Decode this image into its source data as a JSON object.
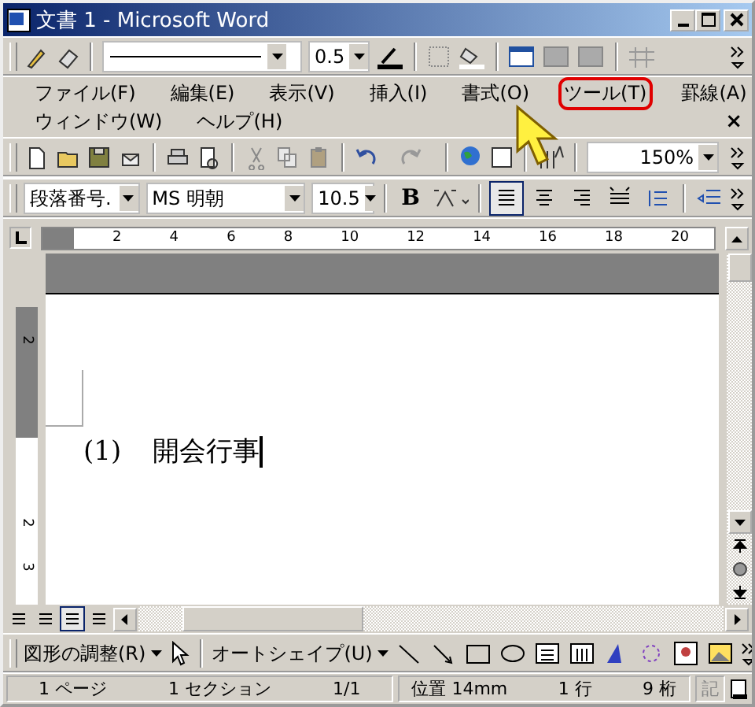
{
  "window": {
    "title": "文書 1 - Microsoft Word"
  },
  "borders_toolbar": {
    "line_weight": "0.5"
  },
  "menu": {
    "rows": [
      [
        {
          "label": "ファイル(F)",
          "selected": false
        },
        {
          "label": "編集(E)",
          "selected": false
        },
        {
          "label": "表示(V)",
          "selected": false
        },
        {
          "label": "挿入(I)",
          "selected": false
        },
        {
          "label": "書式(O)",
          "selected": false
        },
        {
          "label": "ツール(T)",
          "selected": true
        },
        {
          "label": "罫線(A)",
          "selected": false
        }
      ],
      [
        {
          "label": "ウィンドウ(W)",
          "selected": false
        },
        {
          "label": "ヘルプ(H)",
          "selected": false
        }
      ]
    ],
    "close": "×"
  },
  "standard_toolbar": {
    "zoom": "150%"
  },
  "formatting_toolbar": {
    "style": "段落番号.",
    "font": "MS 明朝",
    "size": "10.5",
    "bold": "B"
  },
  "ruler": {
    "labels": [
      "2",
      "4",
      "6",
      "8",
      "10",
      "12",
      "14",
      "16",
      "18",
      "20"
    ],
    "vertical_labels": [
      "2",
      "2",
      "3"
    ]
  },
  "document": {
    "number": "(1)",
    "text": "開会行事"
  },
  "view_buttons": [
    {
      "selected": false
    },
    {
      "selected": false
    },
    {
      "selected": true
    },
    {
      "selected": false
    }
  ],
  "drawing_toolbar": {
    "draw": "図形の調整(R)",
    "autoshapes": "オートシェイプ(U)"
  },
  "status_bar": {
    "page_info": [
      "1 ページ",
      "1 セクション",
      "1/1"
    ],
    "position_info": [
      "位置 14mm",
      "1 行",
      "9 桁"
    ],
    "mode": "記"
  }
}
